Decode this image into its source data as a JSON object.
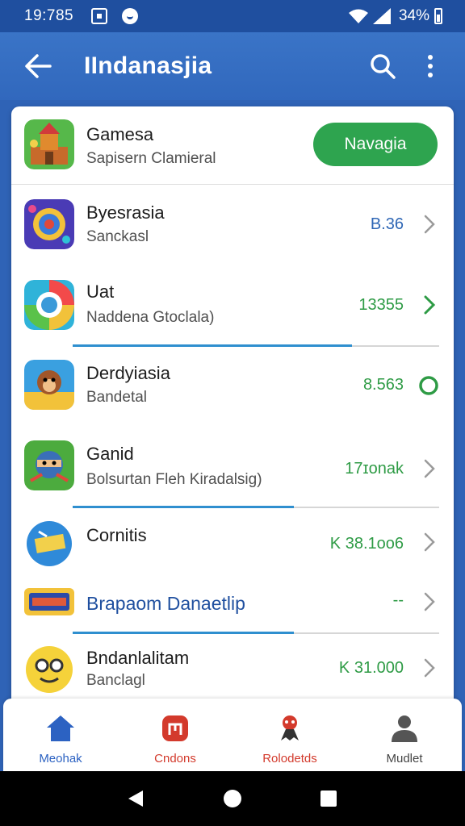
{
  "status_bar": {
    "time": "19:785",
    "battery_pct": "34%"
  },
  "app_bar": {
    "title": "IIndanasjia"
  },
  "header_item": {
    "name": "Gamesa",
    "subtitle": "Sapisern Clamieral",
    "button_label": "Navagia"
  },
  "items": [
    {
      "name": "Byesrasia",
      "subtitle": "Sanckasl",
      "value": "B.36",
      "value_color": "#2f67b5",
      "indicator": "chevron"
    },
    {
      "name": "Uat",
      "subtitle": "Naddena Gtoclala)",
      "value": "13355",
      "value_color": "#2e9b45",
      "indicator": "chevron-green"
    },
    {
      "name": "Derdyiasia",
      "subtitle": "Bandetal",
      "value": "8.563",
      "value_color": "#2e9b45",
      "indicator": "circle"
    },
    {
      "name": "Ganid",
      "subtitle": "Bolsurtan Fleh Kiradalsig)",
      "value": "17ɪonak",
      "value_color": "#2e9b45",
      "indicator": "chevron"
    },
    {
      "name": "Cornitis",
      "subtitle": "",
      "value": "K 38.1ᴏᴏ6",
      "value_color": "#2e9b45",
      "indicator": "chevron"
    },
    {
      "name": "Brapaom Danaetlip",
      "subtitle": "",
      "value": "--",
      "value_color": "#2e9b45",
      "indicator": "chevron"
    },
    {
      "name": "Bndanlalitam",
      "subtitle": "Banclagl",
      "value": "K 31.000",
      "value_color": "#2e9b45",
      "indicator": "chevron"
    }
  ],
  "bottom_nav": [
    {
      "label": "Meohak",
      "color": "#2c62c2",
      "icon": "home-icon"
    },
    {
      "label": "Cndons",
      "color": "#d33a2c",
      "icon": "bag-icon"
    },
    {
      "label": "Rolodetds",
      "color": "#d33a2c",
      "icon": "robot-icon"
    },
    {
      "label": "Mudlet",
      "color": "#444444",
      "icon": "person-icon"
    }
  ],
  "colors": {
    "primary": "#3168bd",
    "accent_green": "#2ea44f",
    "progress": "#2f8fcf"
  }
}
